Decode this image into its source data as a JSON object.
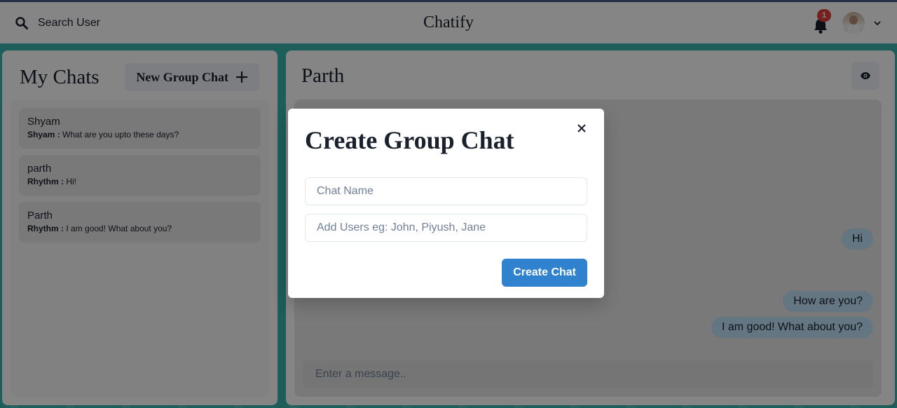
{
  "topbar": {
    "search_label": "Search User",
    "app_title": "Chatify",
    "notification_count": "1"
  },
  "left": {
    "title": "My Chats",
    "new_group_label": "New Group Chat",
    "chats": [
      {
        "name": "Shyam",
        "sender": "Shyam :",
        "message": "What are you upto these days?"
      },
      {
        "name": "parth",
        "sender": "Rhythm :",
        "message": "Hi!"
      },
      {
        "name": "Parth",
        "sender": "Rhythm :",
        "message": "I am good! What about you?"
      }
    ]
  },
  "right": {
    "title": "Parth",
    "messages": [
      "Hi",
      "How are you?",
      "I am good! What about you?"
    ],
    "input_placeholder": "Enter a message.."
  },
  "modal": {
    "title": "Create Group Chat",
    "chat_name_placeholder": "Chat Name",
    "users_placeholder": "Add Users eg: John, Piyush, Jane",
    "create_label": "Create Chat"
  },
  "colors": {
    "background_accent": "#38B2AC",
    "primary_button": "#3182CE",
    "badge": "#E53E3E",
    "bubble": "#BEE3F8"
  }
}
